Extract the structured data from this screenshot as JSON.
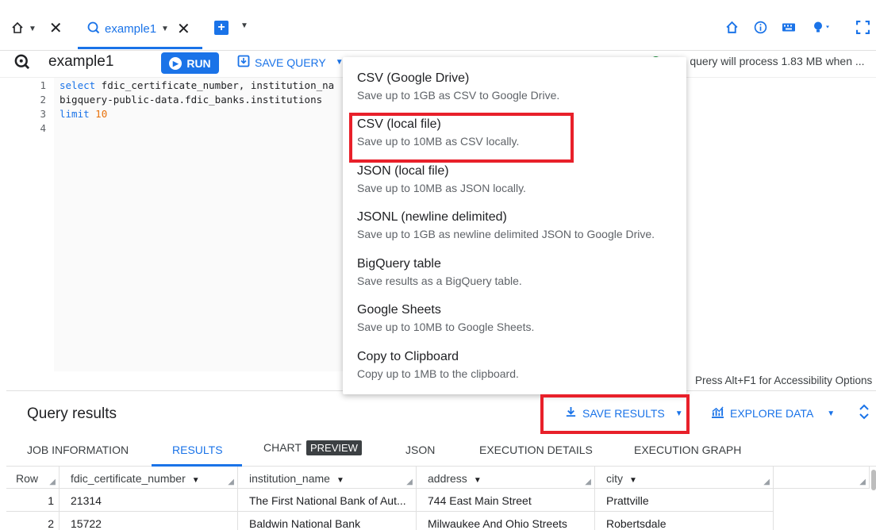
{
  "tabs": {
    "active_tab_label": "example1"
  },
  "query": {
    "title": "example1",
    "run_label": "RUN",
    "save_query_label": "SAVE QUERY",
    "status_text": "This query will process 1.83 MB when ..."
  },
  "editor": {
    "line_numbers": [
      "1",
      "2",
      "3",
      "4"
    ],
    "lines": [
      {
        "kw": "select",
        "rest": " fdic_certificate_number, institution_na"
      },
      {
        "kw": "",
        "rest": "bigquery-public-data.fdic_banks.institutions"
      },
      {
        "kw": "limit",
        "rest": " ",
        "num": "10"
      },
      {
        "kw": "",
        "rest": ""
      }
    ],
    "a11y_hint": "Press Alt+F1 for Accessibility Options"
  },
  "menu": {
    "items": [
      {
        "title": "CSV (Google Drive)",
        "desc": "Save up to 1GB as CSV to Google Drive."
      },
      {
        "title": "CSV (local file)",
        "desc": "Save up to 10MB as CSV locally."
      },
      {
        "title": "JSON (local file)",
        "desc": "Save up to 10MB as JSON locally."
      },
      {
        "title": "JSONL (newline delimited)",
        "desc": "Save up to 1GB as newline delimited JSON to Google Drive."
      },
      {
        "title": "BigQuery table",
        "desc": "Save results as a BigQuery table."
      },
      {
        "title": "Google Sheets",
        "desc": "Save up to 10MB to Google Sheets."
      },
      {
        "title": "Copy to Clipboard",
        "desc": "Copy up to 1MB to the clipboard."
      }
    ]
  },
  "results": {
    "title": "Query results",
    "save_results_label": "SAVE RESULTS",
    "explore_data_label": "EXPLORE DATA",
    "tabs": {
      "job_information": "JOB INFORMATION",
      "results": "RESULTS",
      "chart": "CHART",
      "preview_badge": "PREVIEW",
      "json": "JSON",
      "execution_details": "EXECUTION DETAILS",
      "execution_graph": "EXECUTION GRAPH"
    },
    "columns": [
      "Row",
      "fdic_certificate_number",
      "institution_name",
      "address",
      "city"
    ],
    "rows": [
      [
        "1",
        "21314",
        "The First National Bank of Aut...",
        "744 East Main Street",
        "Prattville"
      ],
      [
        "2",
        "15722",
        "Baldwin National Bank",
        "Milwaukee And Ohio Streets",
        "Robertsdale"
      ]
    ]
  },
  "colors": {
    "accent": "#1a73e8",
    "highlight_box": "#e8202a"
  }
}
